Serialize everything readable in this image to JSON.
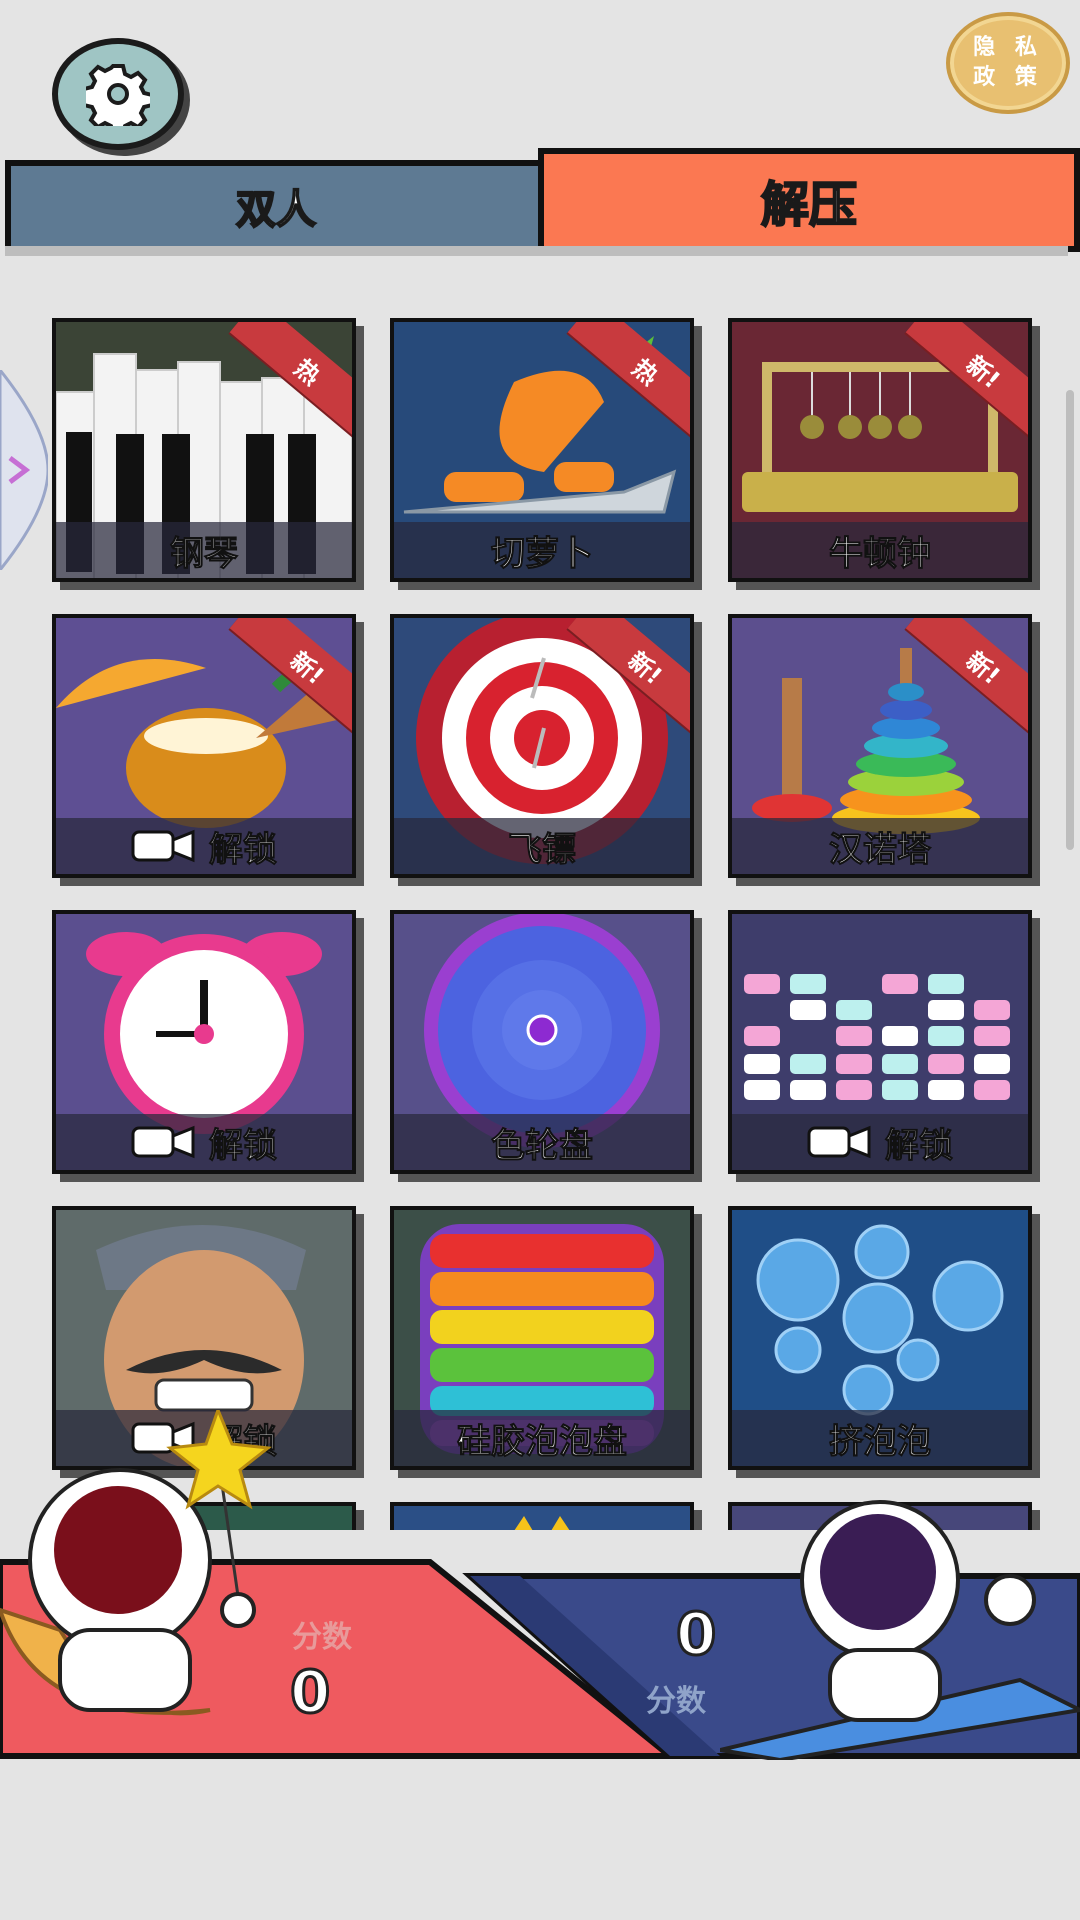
{
  "header": {
    "settings_icon": "gear-icon",
    "privacy_line1": "隐 私",
    "privacy_line2": "政 策"
  },
  "tabs": [
    {
      "label": "双人",
      "active": false
    },
    {
      "label": "解压",
      "active": true
    }
  ],
  "games": [
    {
      "label": "钢琴",
      "badge": "热",
      "locked": false,
      "icon": "piano-icon"
    },
    {
      "label": "切萝卜",
      "badge": "热",
      "locked": false,
      "icon": "carrot-knife-icon"
    },
    {
      "label": "牛顿钟",
      "badge": "新!",
      "locked": false,
      "icon": "newtons-cradle-icon"
    },
    {
      "label": "解锁",
      "badge": "新!",
      "locked": true,
      "icon": "coconut-drink-icon"
    },
    {
      "label": "飞镖",
      "badge": "新!",
      "locked": false,
      "icon": "dartboard-icon"
    },
    {
      "label": "汉诺塔",
      "badge": "新!",
      "locked": false,
      "icon": "ring-stack-tower-icon"
    },
    {
      "label": "解锁",
      "badge": "",
      "locked": true,
      "icon": "alarm-clock-icon"
    },
    {
      "label": "色轮盘",
      "badge": "",
      "locked": false,
      "icon": "color-wheel-icon"
    },
    {
      "label": "解锁",
      "badge": "",
      "locked": true,
      "icon": "equalizer-blocks-icon"
    },
    {
      "label": "解锁",
      "badge": "",
      "locked": true,
      "icon": "angry-man-face-icon"
    },
    {
      "label": "硅胶泡泡盘",
      "badge": "",
      "locked": false,
      "icon": "pop-it-icon"
    },
    {
      "label": "挤泡泡",
      "badge": "",
      "locked": false,
      "icon": "bubbles-icon"
    }
  ],
  "score": {
    "left_label": "分数",
    "left_value": "0",
    "right_label": "分数",
    "right_value": "0",
    "left_color": "#ef5a5f",
    "right_color": "#3a4a8a"
  }
}
